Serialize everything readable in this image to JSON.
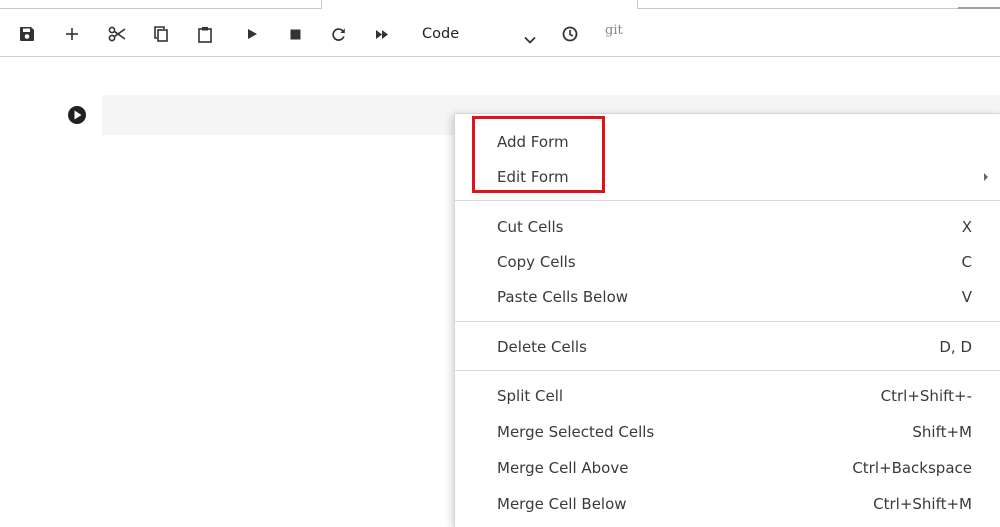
{
  "toolbar": {
    "buttons": [
      {
        "name": "save",
        "icon": "floppy-disk-icon"
      },
      {
        "name": "insert-cell",
        "icon": "plus-icon"
      },
      {
        "name": "cut",
        "icon": "scissors-icon"
      },
      {
        "name": "copy",
        "icon": "copy-icon"
      },
      {
        "name": "paste",
        "icon": "clipboard-icon"
      },
      {
        "name": "run",
        "icon": "play-icon"
      },
      {
        "name": "interrupt",
        "icon": "stop-icon"
      },
      {
        "name": "restart",
        "icon": "refresh-icon"
      },
      {
        "name": "restart-run-all",
        "icon": "fast-forward-icon"
      }
    ],
    "cell_type": "Code",
    "cell_type_icon": "chevron-down-icon",
    "history_icon": "clock-icon",
    "git_label": "git"
  },
  "cell": {
    "run_icon": "run-circle-icon"
  },
  "context_menu": {
    "groups": [
      [
        {
          "label": "Add Form",
          "shortcut": ""
        },
        {
          "label": "Edit Form",
          "shortcut": "",
          "submenu": true
        }
      ],
      [
        {
          "label": "Cut Cells",
          "shortcut": "X"
        },
        {
          "label": "Copy Cells",
          "shortcut": "C"
        },
        {
          "label": "Paste Cells Below",
          "shortcut": "V"
        }
      ],
      [
        {
          "label": "Delete Cells",
          "shortcut": "D, D"
        }
      ],
      [
        {
          "label": "Split Cell",
          "shortcut": "Ctrl+Shift+-"
        },
        {
          "label": "Merge Selected Cells",
          "shortcut": "Shift+M"
        },
        {
          "label": "Merge Cell Above",
          "shortcut": "Ctrl+Backspace"
        },
        {
          "label": "Merge Cell Below",
          "shortcut": "Ctrl+Shift+M"
        }
      ]
    ]
  },
  "colors": {
    "highlight": "#e0121a",
    "cell_background": "#f5f5f5",
    "icon": "#333333"
  }
}
